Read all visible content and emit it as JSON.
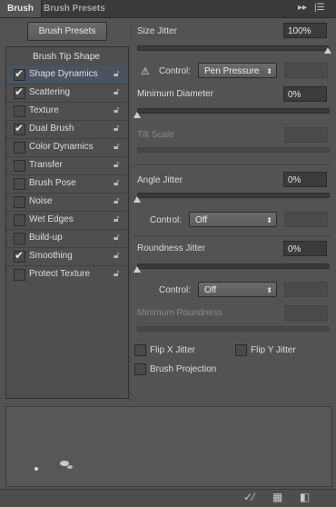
{
  "tabs": [
    {
      "label": "Brush",
      "active": true
    },
    {
      "label": "Brush Presets",
      "active": false
    }
  ],
  "left": {
    "presets_button": "Brush Presets",
    "tip_shape": "Brush Tip Shape",
    "items": [
      {
        "label": "Shape Dynamics",
        "checked": "✔",
        "selected": true
      },
      {
        "label": "Scattering",
        "checked": "✔"
      },
      {
        "label": "Texture",
        "checked": ""
      },
      {
        "label": "Dual Brush",
        "checked": "✔"
      },
      {
        "label": "Color Dynamics",
        "checked": ""
      },
      {
        "label": "Transfer",
        "checked": ""
      },
      {
        "label": "Brush Pose",
        "checked": ""
      },
      {
        "label": "Noise",
        "checked": ""
      },
      {
        "label": "Wet Edges",
        "checked": ""
      },
      {
        "label": "Build-up",
        "checked": ""
      },
      {
        "label": "Smoothing",
        "checked": "✔"
      },
      {
        "label": "Protect Texture",
        "checked": ""
      }
    ]
  },
  "right": {
    "size_jitter": {
      "label": "Size Jitter",
      "value": "100%",
      "level": 1.0
    },
    "control1": {
      "label": "Control:",
      "value": "Pen Pressure"
    },
    "min_diameter": {
      "label": "Minimum Diameter",
      "value": "0%",
      "level": 0.0
    },
    "tilt_scale": {
      "label": "Tilt Scale"
    },
    "angle_jitter": {
      "label": "Angle Jitter",
      "value": "0%",
      "level": 0.0
    },
    "control2": {
      "label": "Control:",
      "value": "Off"
    },
    "roundness_jitter": {
      "label": "Roundness Jitter",
      "value": "0%",
      "level": 0.0
    },
    "control3": {
      "label": "Control:",
      "value": "Off"
    },
    "min_roundness": {
      "label": "Minimum Roundness"
    },
    "flip_x": "Flip X Jitter",
    "flip_y": "Flip Y Jitter",
    "brush_projection": "Brush Projection"
  },
  "colors": {
    "panel": "#535353",
    "selected_row": "#4a5360"
  }
}
